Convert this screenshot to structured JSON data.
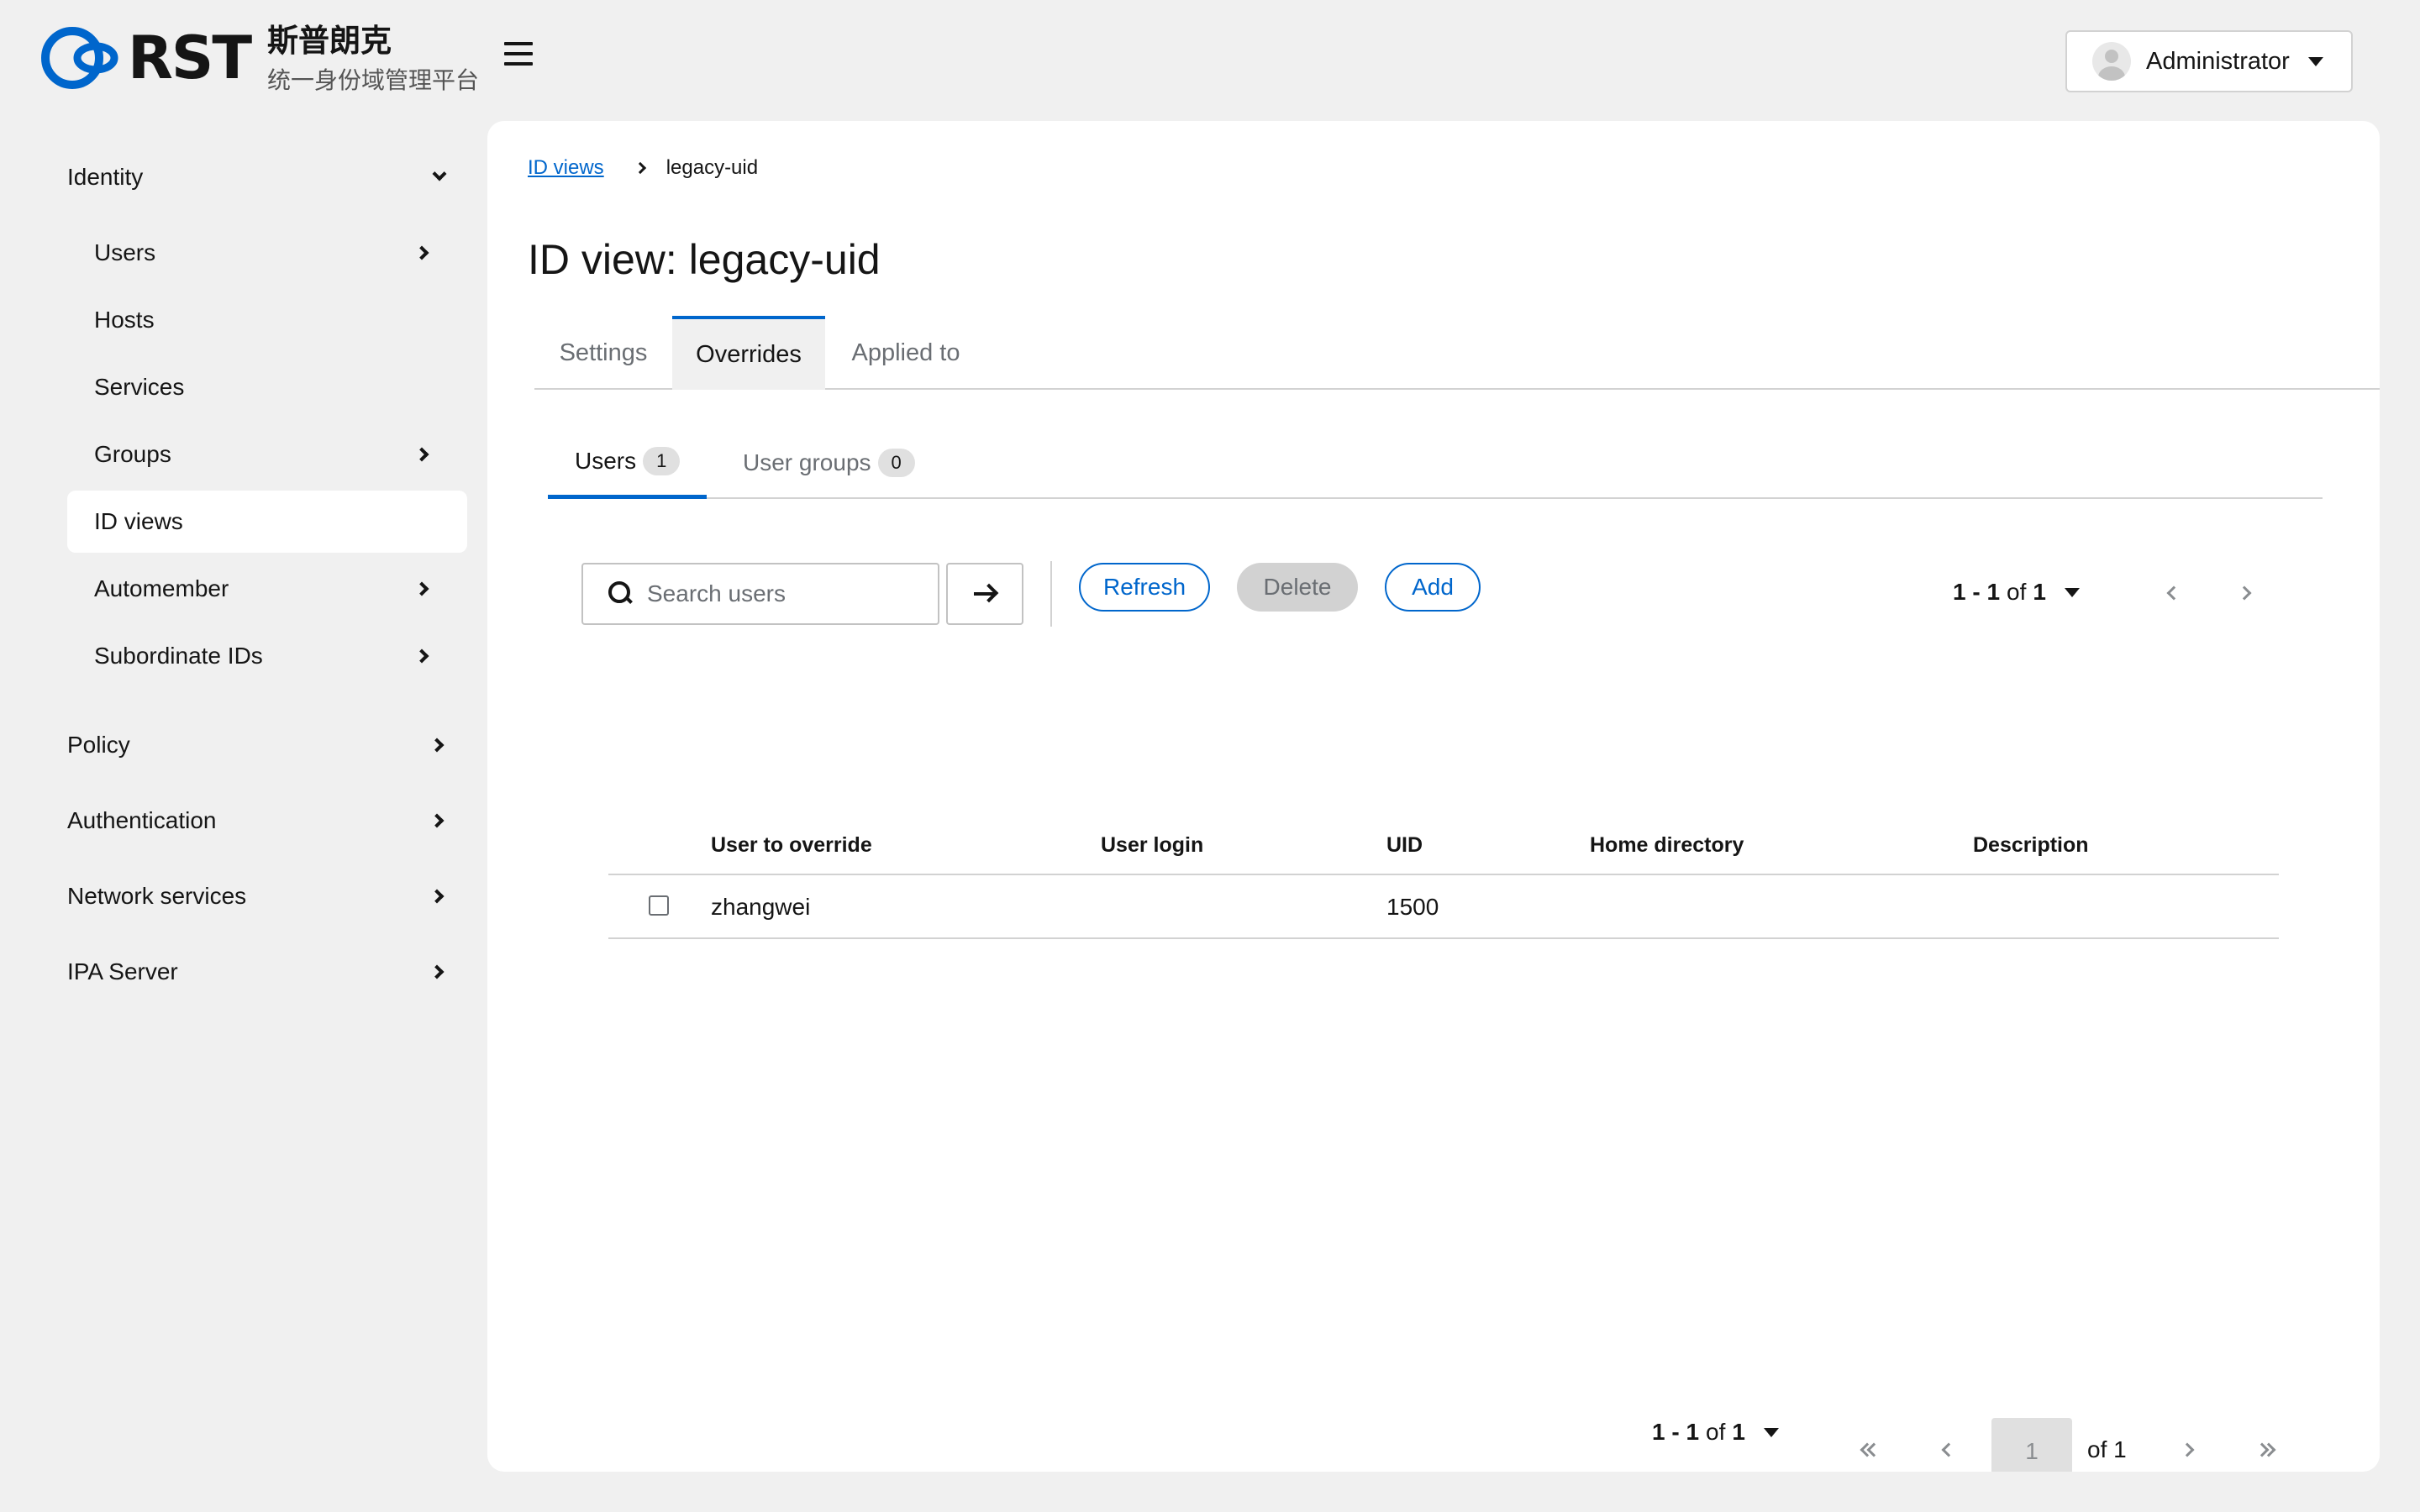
{
  "brand": {
    "logo_text": "RST",
    "name": "斯普朗克",
    "subtitle": "统一身份域管理平台",
    "accent_color": "#0066cc"
  },
  "header": {
    "menu_icon": "hamburger-icon",
    "user_name": "Administrator"
  },
  "sidebar": {
    "identity": {
      "label": "Identity"
    },
    "items": [
      {
        "label": "Users"
      },
      {
        "label": "Hosts"
      },
      {
        "label": "Services"
      },
      {
        "label": "Groups"
      },
      {
        "label": "ID views"
      },
      {
        "label": "Automember"
      },
      {
        "label": "Subordinate IDs"
      }
    ],
    "groups": [
      {
        "label": "Policy"
      },
      {
        "label": "Authentication"
      },
      {
        "label": "Network services"
      },
      {
        "label": "IPA Server"
      }
    ]
  },
  "breadcrumb": {
    "parent": "ID views",
    "current": "legacy-uid"
  },
  "page_title": "ID view: legacy-uid",
  "tabs": [
    {
      "label": "Settings"
    },
    {
      "label": "Overrides"
    },
    {
      "label": "Applied to"
    }
  ],
  "subtabs": [
    {
      "label": "Users",
      "count": "1"
    },
    {
      "label": "User groups",
      "count": "0"
    }
  ],
  "toolbar": {
    "search_placeholder": "Search users",
    "refresh_label": "Refresh",
    "delete_label": "Delete",
    "add_label": "Add"
  },
  "pagination_top": {
    "range": "1 - 1",
    "of_word": "of",
    "total": "1"
  },
  "table": {
    "columns": [
      "User to override",
      "User login",
      "UID",
      "Home directory",
      "Description"
    ],
    "rows": [
      {
        "user_to_override": "zhangwei",
        "user_login": "",
        "uid": "1500",
        "home_directory": "",
        "description": ""
      }
    ]
  },
  "pagination_bottom": {
    "range": "1 - 1",
    "of_word": "of",
    "total": "1",
    "current_page": "1",
    "of_pages": "of 1"
  }
}
